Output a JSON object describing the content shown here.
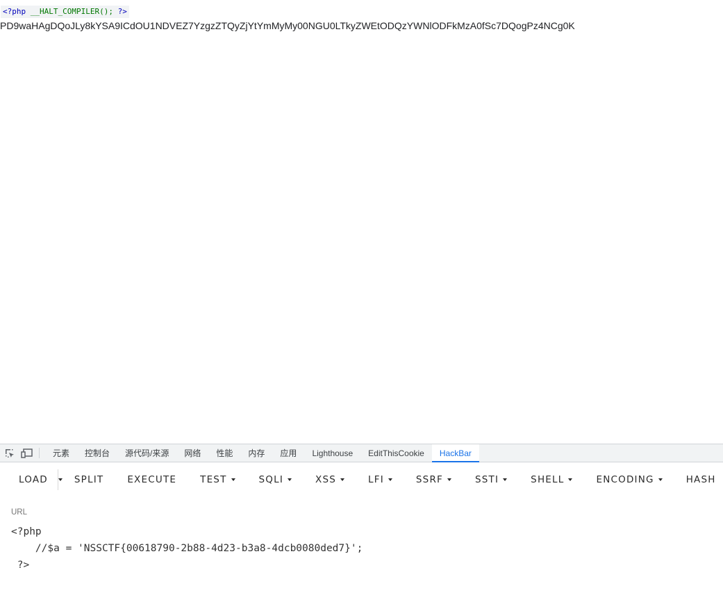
{
  "page": {
    "php_open": "<?php",
    "php_call": "__HALT_COMPILER();",
    "php_close": "?>",
    "base64_text": "PD9waHAgDQoJLy8kYSA9ICdOU1NDVEZ7YzgzZTQyZjYtYmMyMy00NGU0LTkyZWEtODQzYWNlODFkMzA0fSc7DQogPz4NCg0K"
  },
  "devtools": {
    "tabs": [
      {
        "label": "元素"
      },
      {
        "label": "控制台"
      },
      {
        "label": "源代码/来源"
      },
      {
        "label": "网络"
      },
      {
        "label": "性能"
      },
      {
        "label": "内存"
      },
      {
        "label": "应用"
      },
      {
        "label": "Lighthouse"
      },
      {
        "label": "EditThisCookie"
      },
      {
        "label": "HackBar"
      }
    ],
    "active_tab": "HackBar",
    "accent_color": "#1a73e8"
  },
  "hackbar": {
    "load": "LOAD",
    "split": "SPLIT",
    "execute": "EXECUTE",
    "test": "TEST",
    "sqli": "SQLI",
    "xss": "XSS",
    "lfi": "LFI",
    "ssrf": "SSRF",
    "ssti": "SSTI",
    "shell": "SHELL",
    "encoding": "ENCODING",
    "hash": "HASH",
    "url_label": "URL",
    "url_value": "<?php\n    //$a = 'NSSCTF{00618790-2b88-4d23-b3a8-4dcb0080ded7}';\n ?>"
  }
}
